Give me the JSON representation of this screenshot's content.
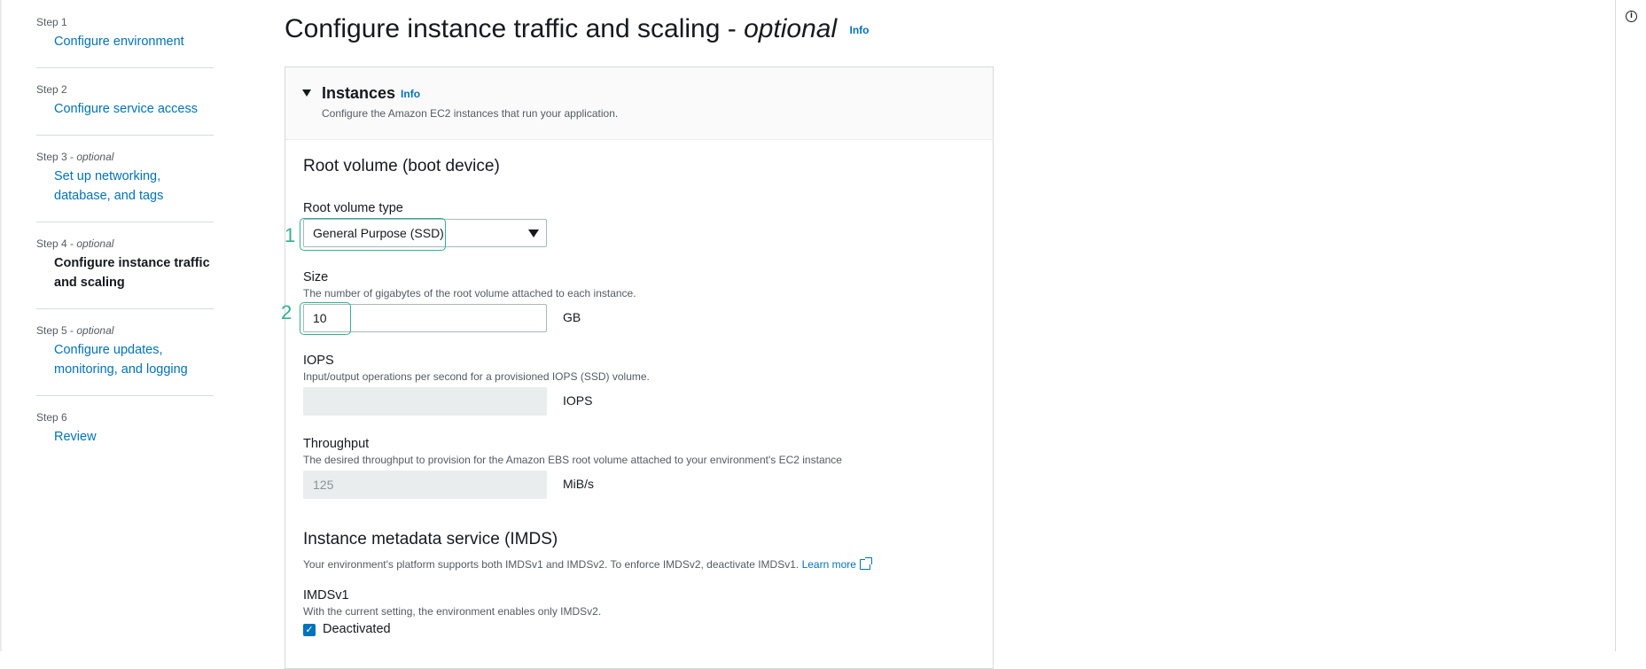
{
  "nav": {
    "steps": [
      {
        "num": "Step 1",
        "label": "Configure environment"
      },
      {
        "num": "Step 2",
        "label": "Configure service access"
      },
      {
        "num": "Step 3",
        "opt": "optional",
        "label": "Set up networking, database, and tags"
      },
      {
        "num": "Step 4",
        "opt": "optional",
        "label": "Configure instance traffic and scaling"
      },
      {
        "num": "Step 5",
        "opt": "optional",
        "label": "Configure updates, monitoring, and logging"
      },
      {
        "num": "Step 6",
        "label": "Review"
      }
    ]
  },
  "header": {
    "title": "Configure instance traffic and scaling - ",
    "title_optional": "optional",
    "info": "Info"
  },
  "instances": {
    "title": "Instances",
    "info": "Info",
    "description": "Configure the Amazon EC2 instances that run your application."
  },
  "root_volume": {
    "title": "Root volume (boot device)",
    "type_label": "Root volume type",
    "type_value": "General Purpose (SSD)",
    "size_label": "Size",
    "size_desc": "The number of gigabytes of the root volume attached to each instance.",
    "size_value": "10",
    "size_unit": "GB",
    "iops_label": "IOPS",
    "iops_desc": "Input/output operations per second for a provisioned IOPS (SSD) volume.",
    "iops_value": "",
    "iops_unit": "IOPS",
    "throughput_label": "Throughput",
    "throughput_desc": "The desired throughput to provision for the Amazon EBS root volume attached to your environment's EC2 instance",
    "throughput_value": "125",
    "throughput_unit": "MiB/s"
  },
  "imds": {
    "title": "Instance metadata service (IMDS)",
    "description": "Your environment's platform supports both IMDSv1 and IMDSv2. To enforce IMDSv2, deactivate IMDSv1.",
    "learn_more": "Learn more",
    "v1_label": "IMDSv1",
    "v1_desc": "With the current setting, the environment enables only IMDSv2.",
    "checkbox_label": "Deactivated",
    "checked": true
  },
  "annotations": [
    "1",
    "2"
  ]
}
